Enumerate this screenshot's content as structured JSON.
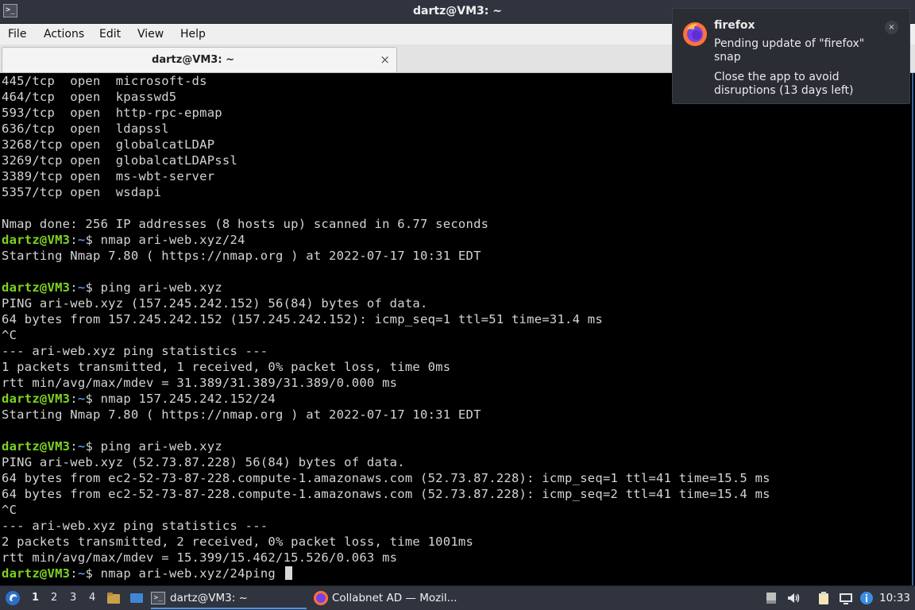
{
  "window": {
    "title": "dartz@VM3: ~",
    "tab_title": "dartz@VM3: ~",
    "tab_close": "×"
  },
  "menu": [
    "File",
    "Actions",
    "Edit",
    "View",
    "Help"
  ],
  "prompt": {
    "user": "dartz@VM3",
    "sep": ":",
    "path": "~",
    "sign": "$ "
  },
  "terminal_lines": [
    {
      "t": "out",
      "text": "445/tcp  open  microsoft-ds"
    },
    {
      "t": "out",
      "text": "464/tcp  open  kpasswd5"
    },
    {
      "t": "out",
      "text": "593/tcp  open  http-rpc-epmap"
    },
    {
      "t": "out",
      "text": "636/tcp  open  ldapssl"
    },
    {
      "t": "out",
      "text": "3268/tcp open  globalcatLDAP"
    },
    {
      "t": "out",
      "text": "3269/tcp open  globalcatLDAPssl"
    },
    {
      "t": "out",
      "text": "3389/tcp open  ms-wbt-server"
    },
    {
      "t": "out",
      "text": "5357/tcp open  wsdapi"
    },
    {
      "t": "out",
      "text": ""
    },
    {
      "t": "out",
      "text": "Nmap done: 256 IP addresses (8 hosts up) scanned in 6.77 seconds"
    },
    {
      "t": "cmd",
      "text": "nmap ari-web.xyz/24"
    },
    {
      "t": "out",
      "text": "Starting Nmap 7.80 ( https://nmap.org ) at 2022-07-17 10:31 EDT"
    },
    {
      "t": "out",
      "text": ""
    },
    {
      "t": "cmd",
      "text": "ping ari-web.xyz"
    },
    {
      "t": "out",
      "text": "PING ari-web.xyz (157.245.242.152) 56(84) bytes of data."
    },
    {
      "t": "out",
      "text": "64 bytes from 157.245.242.152 (157.245.242.152): icmp_seq=1 ttl=51 time=31.4 ms"
    },
    {
      "t": "out",
      "text": "^C"
    },
    {
      "t": "out",
      "text": "--- ari-web.xyz ping statistics ---"
    },
    {
      "t": "out",
      "text": "1 packets transmitted, 1 received, 0% packet loss, time 0ms"
    },
    {
      "t": "out",
      "text": "rtt min/avg/max/mdev = 31.389/31.389/31.389/0.000 ms"
    },
    {
      "t": "cmd",
      "text": "nmap 157.245.242.152/24"
    },
    {
      "t": "out",
      "text": "Starting Nmap 7.80 ( https://nmap.org ) at 2022-07-17 10:31 EDT"
    },
    {
      "t": "out",
      "text": ""
    },
    {
      "t": "cmd",
      "text": "ping ari-web.xyz"
    },
    {
      "t": "out",
      "text": "PING ari-web.xyz (52.73.87.228) 56(84) bytes of data."
    },
    {
      "t": "out",
      "text": "64 bytes from ec2-52-73-87-228.compute-1.amazonaws.com (52.73.87.228): icmp_seq=1 ttl=41 time=15.5 ms"
    },
    {
      "t": "out",
      "text": "64 bytes from ec2-52-73-87-228.compute-1.amazonaws.com (52.73.87.228): icmp_seq=2 ttl=41 time=15.4 ms"
    },
    {
      "t": "out",
      "text": "^C"
    },
    {
      "t": "out",
      "text": "--- ari-web.xyz ping statistics ---"
    },
    {
      "t": "out",
      "text": "2 packets transmitted, 2 received, 0% packet loss, time 1001ms"
    },
    {
      "t": "out",
      "text": "rtt min/avg/max/mdev = 15.399/15.462/15.526/0.063 ms"
    },
    {
      "t": "cmd",
      "text": "nmap ari-web.xyz/24ping ",
      "cursor": true
    }
  ],
  "notification": {
    "app": "firefox",
    "body": "Pending update of \"firefox\" snap",
    "body2": "Close the app to avoid disruptions (13 days left)",
    "close": "×",
    "icon": "firefox-icon"
  },
  "taskbar": {
    "workspaces": [
      "1",
      "2",
      "3",
      "4"
    ],
    "active_workspace": "1",
    "windows": [
      {
        "label": "dartz@VM3: ~",
        "icon": "terminal-icon",
        "active": true
      },
      {
        "label": "Collabnet AD — Mozil...",
        "icon": "firefox-icon",
        "active": false
      }
    ],
    "clock": "10:33"
  },
  "colors": {
    "prompt_user": "#7ed321",
    "prompt_path": "#5c8fe6",
    "panel_bg": "#2f343f",
    "accent": "#5294e2"
  }
}
